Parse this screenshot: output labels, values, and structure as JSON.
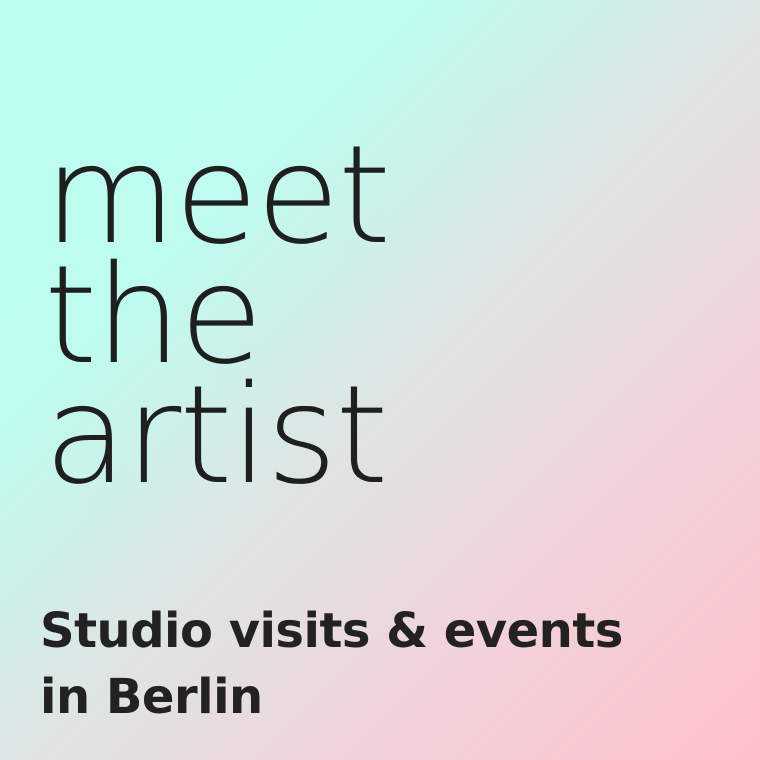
{
  "headline": {
    "lines": [
      "meet",
      "the",
      "artist"
    ]
  },
  "subtitle": {
    "lines": [
      "Studio visits & events",
      "in Berlin"
    ]
  },
  "colors": {
    "gradient_start": "#bdfff0",
    "gradient_end": "#ffc0cb",
    "text": "#222222"
  }
}
